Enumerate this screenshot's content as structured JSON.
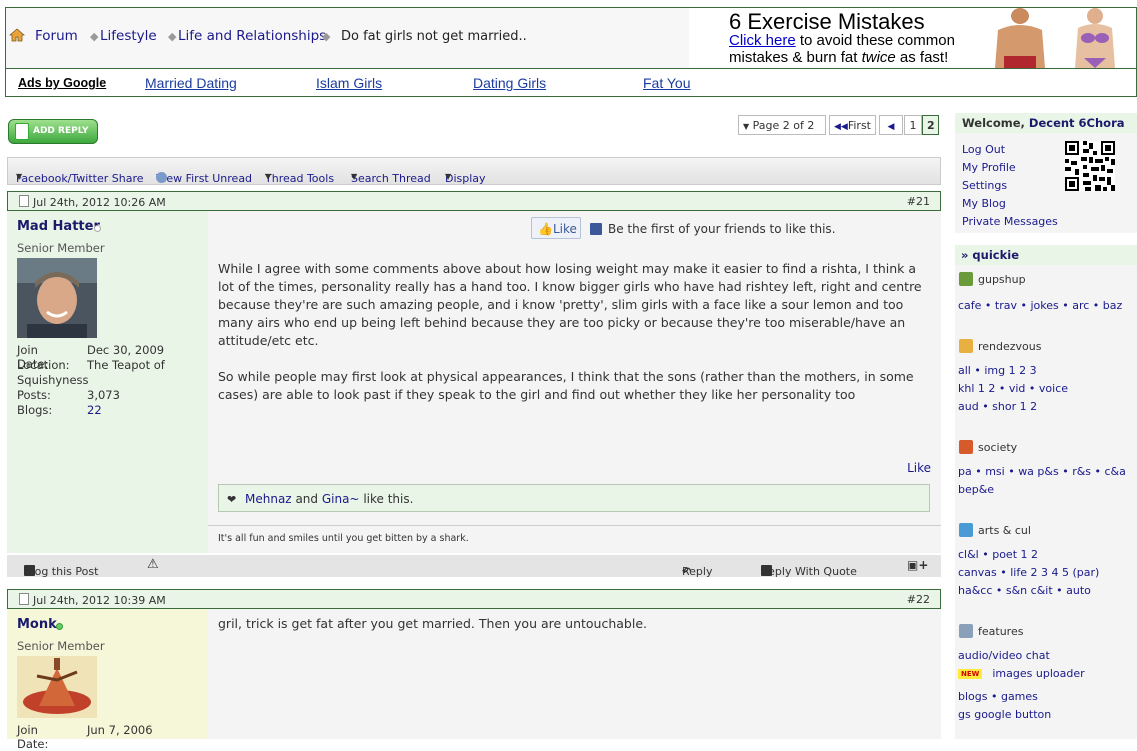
{
  "breadcrumb": {
    "items": [
      "Forum",
      "Lifestyle",
      "Life and Relationships"
    ],
    "current": "Do fat girls not get married.."
  },
  "ad_banner": {
    "title": "6 Exercise Mistakes",
    "link": "Click here",
    "text_a": " to avoid these common mistakes & burn fat ",
    "text_em": "twice",
    "text_b": " as fast!"
  },
  "ads_row": {
    "label": "Ads by Google",
    "links": [
      "Married Dating",
      "Islam Girls",
      "Dating Girls",
      "Fat You"
    ]
  },
  "toolbar": {
    "add_reply": "ADD REPLY",
    "page_of": "Page 2 of 2",
    "first": "First",
    "pages": [
      "1",
      "2"
    ],
    "items": [
      "Facebook/Twitter Share",
      "View First Unread",
      "Thread Tools",
      "Search Thread",
      "Display"
    ]
  },
  "posts": [
    {
      "date": "Jul 24th, 2012 10:26 AM",
      "number": "#21",
      "username": "Mad Hatter",
      "user_title": "Senior Member",
      "join_label": "Join Date:",
      "join_date": "Dec 30, 2009",
      "location_label": "Location:",
      "location_line1": "The Teapot of",
      "location_line2": "Squishyness",
      "posts_label": "Posts:",
      "posts_count": "3,073",
      "blogs_label": "Blogs:",
      "blogs_count": "22",
      "like_button": "Like",
      "fb_note": "Be the first of your friends to like this.",
      "paragraphs": [
        "While I agree with some comments above about how losing weight may make it easier to find a rishta, I think a lot of the times, personality really has a hand too. I know bigger girls who have had rishtey left, right and centre because they're are such amazing people, and i know 'pretty', slim girls with a face like a sour lemon and too many airs who end up being left behind because they are too picky or because they're too miserable/have an attitude/etc etc.",
        "So while people may first look at physical appearances, I think that the sons (rather than the mothers, in some cases) are able to look past if they speak to the girl and find out whether they like her personality too"
      ],
      "like_link": "Like",
      "liker1": "Mehnaz",
      "likers_and": "and",
      "liker2": "Gina~",
      "like_suffix": "like this.",
      "signature": "It's all fun and smiles until you get bitten by a shark.",
      "footer": {
        "blog_this": "Blog this Post",
        "reply": "Reply",
        "reply_quote": "Reply With Quote"
      }
    },
    {
      "date": "Jul 24th, 2012 10:39 AM",
      "number": "#22",
      "username": "Monk",
      "user_title": "Senior Member",
      "join_label": "Join Date:",
      "join_date": "Jun 7, 2006",
      "message": "gril, trick is get fat after you get married. Then you are untouchable."
    }
  ],
  "sidebar": {
    "welcome": "Welcome,",
    "user": "Decent 6Chora",
    "account_links": [
      "Log Out",
      "My Profile",
      "Settings",
      "My Blog",
      "Private Messages"
    ],
    "quickie_title": "» quickie",
    "sections": {
      "gupshup": "gupshup",
      "gupshup_links": "cafe • trav • jokes • arc • baz",
      "rendezvous": "rendezvous",
      "rendezvous_l1": "all • img 1 2 3",
      "rendezvous_l2": "khl 1 2 • vid • voice",
      "rendezvous_l3": "aud • shor 1 2",
      "society": "society",
      "society_l1": "pa • msi • wa p&s • r&s • c&a",
      "society_l2": "bep&e",
      "arts": "arts & cul",
      "arts_l1": "cl&l • poet 1 2",
      "arts_l2": "canvas • life 2 3 4 5 (par)",
      "arts_l3": "ha&cc • s&n c&it • auto",
      "features": "features",
      "features_l1": "audio/video chat",
      "features_new": "NEW",
      "features_l2": "images uploader",
      "features_l3": "blogs • games",
      "features_l4": "gs google button"
    }
  }
}
